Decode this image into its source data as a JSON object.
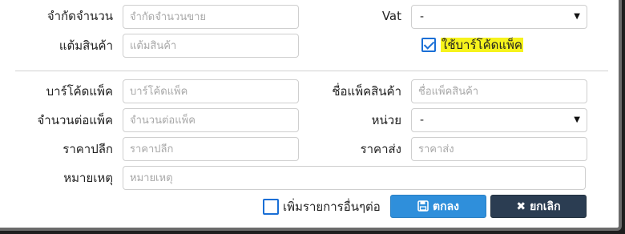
{
  "form": {
    "limit_qty": {
      "label": "จำกัดจำนวน",
      "placeholder": "จำกัดจำนวนขาย"
    },
    "vat": {
      "label": "Vat",
      "value": "-"
    },
    "points": {
      "label": "แต้มสินค้า",
      "placeholder": "แต้มสินค้า"
    },
    "use_pack_barcode": {
      "label": "ใช้บาร์โค้ดแพ็ค",
      "checked": true
    },
    "pack_barcode": {
      "label": "บาร์โค้ดแพ็ค",
      "placeholder": "บาร์โค้ดแพ็ค"
    },
    "pack_name": {
      "label": "ชื่อแพ็คสินค้า",
      "placeholder": "ชื่อแพ็คสินค้า"
    },
    "qty_per_pack": {
      "label": "จำนวนต่อแพ็ค",
      "placeholder": "จำนวนต่อแพ็ค"
    },
    "unit": {
      "label": "หน่วย",
      "value": "-"
    },
    "retail_price": {
      "label": "ราคาปลีก",
      "placeholder": "ราคาปลีก"
    },
    "wholesale_price": {
      "label": "ราคาส่ง",
      "placeholder": "ราคาส่ง"
    },
    "note": {
      "label": "หมายเหตุ",
      "placeholder": "หมายเหตุ"
    }
  },
  "footer": {
    "add_more": {
      "label": "เพิ่มรายการอื่นๆต่อ",
      "checked": false
    },
    "ok_label": "ตกลง",
    "cancel_label": "ยกเลิก"
  },
  "icons": {
    "ok": "floppy-disk-icon",
    "cancel": "times-icon",
    "caret": "caret-down-icon"
  },
  "colors": {
    "primary": "#2f8fdb",
    "dark": "#2b3d52",
    "highlight": "#f6f31c",
    "checkbox": "#1a6fd6"
  }
}
